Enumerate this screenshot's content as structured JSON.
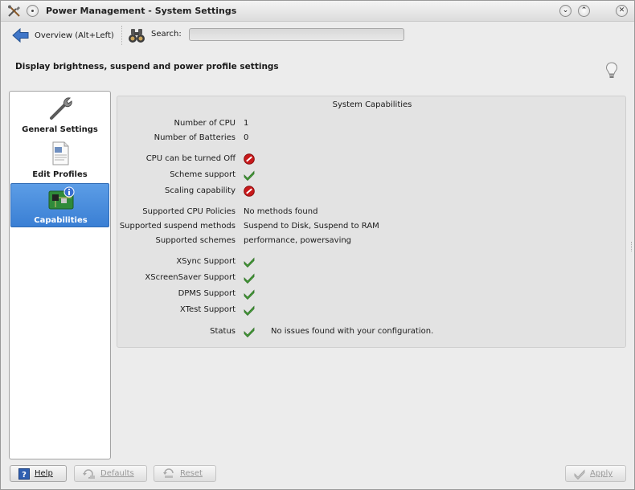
{
  "window": {
    "title": "Power Management - System Settings",
    "minimize_glyph": "⌄",
    "maximize_glyph": "⌃",
    "close_glyph": "✕"
  },
  "toolbar": {
    "overview_label": "Overview (Alt+Left)",
    "search_label": "Search:",
    "search_value": ""
  },
  "page": {
    "description": "Display brightness, suspend and power profile settings"
  },
  "sidebar": {
    "items": [
      {
        "label": "General Settings",
        "icon": "wrench-icon",
        "selected": false
      },
      {
        "label": "Edit Profiles",
        "icon": "document-icon",
        "selected": false
      },
      {
        "label": "Capabilities",
        "icon": "circuit-board-icon",
        "selected": true
      }
    ]
  },
  "capabilities": {
    "title": "System Capabilities",
    "num_cpu_label": "Number of CPU",
    "num_cpu_value": "1",
    "num_batteries_label": "Number of Batteries",
    "num_batteries_value": "0",
    "cpu_off_label": "CPU can be turned Off",
    "cpu_off_status": "no",
    "scheme_support_label": "Scheme support",
    "scheme_support_status": "yes",
    "scaling_label": "Scaling capability",
    "scaling_status": "no",
    "cpu_policies_label": "Supported CPU Policies",
    "cpu_policies_value": "No methods found",
    "suspend_methods_label": "Supported suspend methods",
    "suspend_methods_value": "Suspend to Disk, Suspend to RAM",
    "schemes_label": "Supported schemes",
    "schemes_value": "performance, powersaving",
    "xsync_label": "XSync Support",
    "xsync_status": "yes",
    "xscreensaver_label": "XScreenSaver Support",
    "xscreensaver_status": "yes",
    "dpms_label": "DPMS Support",
    "dpms_status": "yes",
    "xtest_label": "XTest Support",
    "xtest_status": "yes",
    "status_label": "Status",
    "status_status": "yes",
    "status_value": "No issues found with your configuration."
  },
  "buttons": {
    "help": "Help",
    "defaults": "Defaults",
    "reset": "Reset",
    "apply": "Apply"
  },
  "colors": {
    "selection": "#3a7fd4",
    "ok_green": "#4aa43c",
    "error_red": "#c8191b"
  }
}
